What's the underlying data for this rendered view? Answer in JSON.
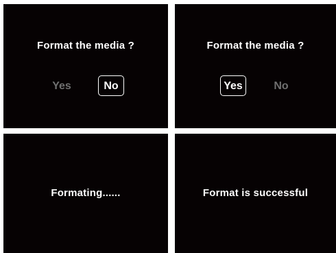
{
  "screens": [
    {
      "title": "Format the media ?",
      "yes_label": "Yes",
      "no_label": "No",
      "selected": "No"
    },
    {
      "title": "Format the media ?",
      "yes_label": "Yes",
      "no_label": "No",
      "selected": "Yes"
    },
    {
      "message": "Formating......"
    },
    {
      "message": "Format is successful"
    }
  ],
  "colors": {
    "panel_background": "#060203",
    "text": "#ffffff",
    "dimmed_text": "#6f6f6f",
    "page_background": "#ffffff"
  }
}
